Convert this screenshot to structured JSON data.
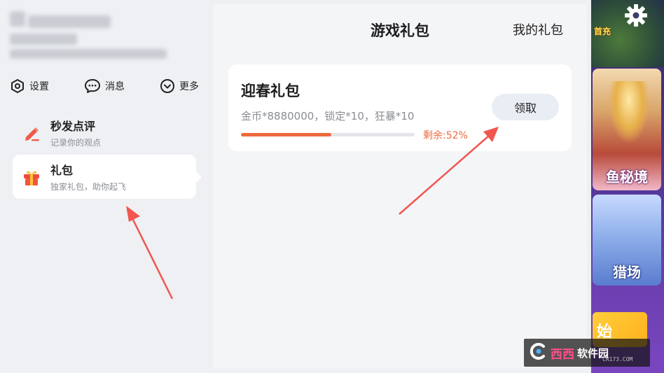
{
  "left_panel": {
    "quick_actions": [
      {
        "label": "设置",
        "icon": "settings-hex-icon"
      },
      {
        "label": "消息",
        "icon": "message-bubble-icon"
      },
      {
        "label": "更多",
        "icon": "chevron-circle-icon"
      }
    ],
    "menu": [
      {
        "title": "秒发点评",
        "subtitle": "记录你的观点",
        "icon": "pencil-icon",
        "active": false
      },
      {
        "title": "礼包",
        "subtitle": "独家礼包，助你起飞",
        "icon": "gift-icon",
        "active": true
      }
    ]
  },
  "main": {
    "title": "游戏礼包",
    "my_gifts_label": "我的礼包",
    "gift": {
      "name": "迎春礼包",
      "description": "金币*8880000，锁定*10，狂暴*10",
      "remaining_label": "剩余:52%",
      "remaining_fraction": 0.52,
      "claim_label": "领取"
    }
  },
  "game_strip": {
    "badge": "首充",
    "card_labels": [
      "鱼秘境",
      "猎场"
    ],
    "promo_text": "始"
  },
  "watermark": {
    "brand": "西西",
    "suffix": "软件园",
    "url": "CR173.COM"
  },
  "colors": {
    "accent": "#ee6a3c",
    "panel_bg": "#eef0f3",
    "card_bg": "#ffffff",
    "arrow": "#f0564e"
  }
}
